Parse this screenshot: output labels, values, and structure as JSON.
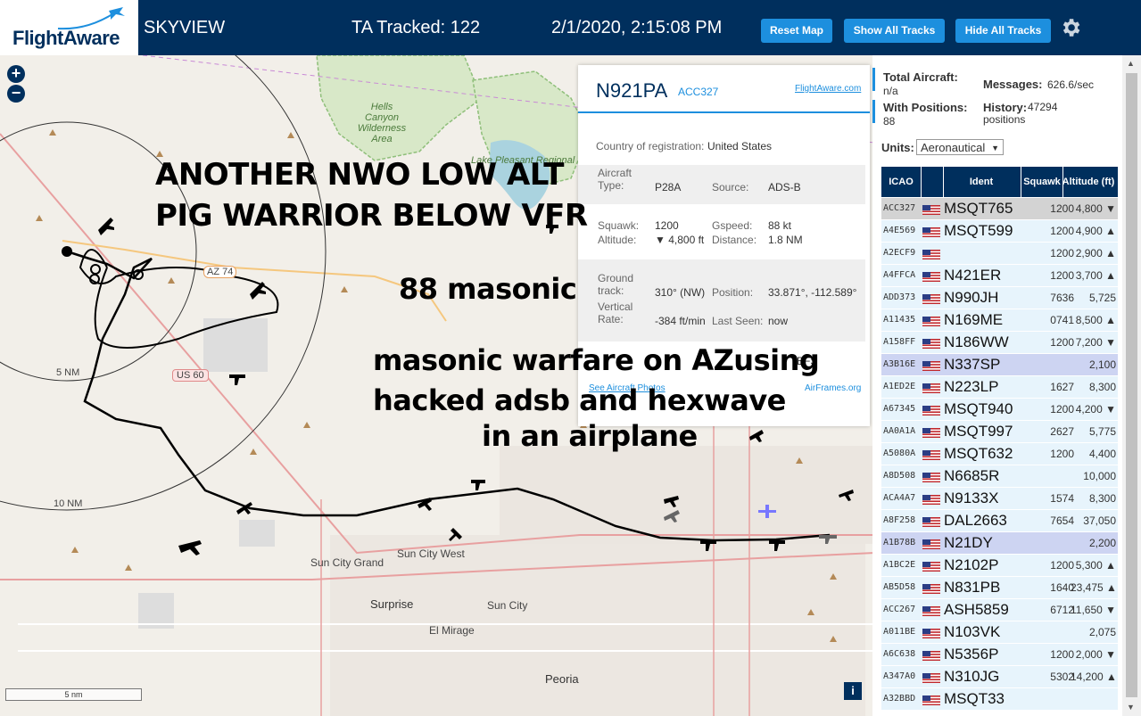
{
  "header": {
    "brand": "FlightAware",
    "app_name": "SKYVIEW",
    "tracked_label": "TA Tracked: 122",
    "datetime": "2/1/2020, 2:15:08 PM",
    "reset_map": "Reset Map",
    "show_all_tracks": "Show All Tracks",
    "hide_all_tracks": "Hide All Tracks",
    "settings_icon": "gear-icon"
  },
  "map": {
    "zoom_in": "+",
    "zoom_out": "−",
    "labels": {
      "hells_canyon": "Hells Canyon Wilderness Area",
      "lake_pleasant": "Lake Pleasant Regional",
      "az74": "AZ 74",
      "us60": "US 60",
      "range5": "5 NM",
      "range10": "10 NM",
      "sun_city_grand": "Sun City Grand",
      "sun_city_west": "Sun City West",
      "sun_city": "Sun City",
      "surprise": "Surprise",
      "el_mirage": "El Mirage",
      "peoria": "Peoria"
    },
    "scale_label": "5 nm",
    "info_button": "i"
  },
  "overlay_text": {
    "line1": "ANOTHER NWO LOW ALT",
    "line2": "PIG WARRIOR BELOW VFR",
    "line3": "88 masonic",
    "line4": "masonic warfare on AZusing",
    "line5": "hacked adsb and hexwave",
    "line6": "in an airplane"
  },
  "popup": {
    "ident": "N921PA",
    "icao": "ACC327",
    "fa_link": "FlightAware.com",
    "country_label": "Country of registration:",
    "country": "United States",
    "aircraft_type_label": "Aircraft Type:",
    "aircraft_type": "P28A",
    "source_label": "Source:",
    "source": "ADS-B",
    "squawk_label": "Squawk:",
    "squawk": "1200",
    "altitude_label": "Altitude:",
    "altitude": "▼ 4,800 ft",
    "gspeed_label": "Gspeed:",
    "gspeed": "88 kt",
    "distance_label": "Distance:",
    "distance": "1.8 NM",
    "ground_track_label": "Ground track:",
    "ground_track": "310° (NW)",
    "position_label": "Position:",
    "position": "33.871°, -112.589°",
    "vertical_rate_label": "Vertical Rate:",
    "vertical_rate": "-384 ft/min",
    "last_seen_label": "Last Seen:",
    "last_seen": "now",
    "bottom_fragment": "BFS",
    "see_photos": "See Aircraft Photos",
    "airframes_link": "AirFrames.org"
  },
  "panel": {
    "total_aircraft_label": "Total Aircraft:",
    "total_aircraft": "n/a",
    "with_positions_label": "With Positions:",
    "with_positions": "88",
    "messages_label": "Messages:",
    "messages": "626.6/sec",
    "history_label": "History:",
    "history": "47294 positions",
    "units_label": "Units:",
    "units_value": "Aeronautical",
    "columns": {
      "icao": "ICAO",
      "ident": "Ident",
      "squawk": "Squawk",
      "altitude": "Altitude (ft)"
    },
    "rows": [
      {
        "icao": "ACC327",
        "ident": "MSQT765",
        "squawk": "1200",
        "alt": "4,800 ▼",
        "hl": "sel"
      },
      {
        "icao": "A4E569",
        "ident": "MSQT599",
        "squawk": "1200",
        "alt": "4,900 ▲",
        "hl": ""
      },
      {
        "icao": "A2ECF9",
        "ident": "",
        "squawk": "1200",
        "alt": "2,900 ▲",
        "hl": ""
      },
      {
        "icao": "A4FFCA",
        "ident": "N421ER",
        "squawk": "1200",
        "alt": "3,700 ▲",
        "hl": ""
      },
      {
        "icao": "ADD373",
        "ident": "N990JH",
        "squawk": "7636",
        "alt": "5,725",
        "hl": ""
      },
      {
        "icao": "A11435",
        "ident": "N169ME",
        "squawk": "0741",
        "alt": "8,500 ▲",
        "hl": ""
      },
      {
        "icao": "A158FF",
        "ident": "N186WW",
        "squawk": "1200",
        "alt": "7,200 ▼",
        "hl": ""
      },
      {
        "icao": "A3B16E",
        "ident": "N337SP",
        "squawk": "",
        "alt": "2,100",
        "hl": "blue"
      },
      {
        "icao": "A1ED2E",
        "ident": "N223LP",
        "squawk": "1627",
        "alt": "8,300",
        "hl": ""
      },
      {
        "icao": "A67345",
        "ident": "MSQT940",
        "squawk": "1200",
        "alt": "4,200 ▼",
        "hl": ""
      },
      {
        "icao": "AA0A1A",
        "ident": "MSQT997",
        "squawk": "2627",
        "alt": "5,775",
        "hl": ""
      },
      {
        "icao": "A5080A",
        "ident": "MSQT632",
        "squawk": "1200",
        "alt": "4,400",
        "hl": ""
      },
      {
        "icao": "A8D508",
        "ident": "N6685R",
        "squawk": "",
        "alt": "10,000",
        "hl": ""
      },
      {
        "icao": "ACA4A7",
        "ident": "N9133X",
        "squawk": "1574",
        "alt": "8,300",
        "hl": ""
      },
      {
        "icao": "A8F258",
        "ident": "DAL2663",
        "squawk": "7654",
        "alt": "37,050",
        "hl": ""
      },
      {
        "icao": "A1B78B",
        "ident": "N21DY",
        "squawk": "",
        "alt": "2,200",
        "hl": "blue"
      },
      {
        "icao": "A1BC2E",
        "ident": "N2102P",
        "squawk": "1200",
        "alt": "5,300 ▲",
        "hl": ""
      },
      {
        "icao": "AB5D58",
        "ident": "N831PB",
        "squawk": "1640",
        "alt": "23,475 ▲",
        "hl": ""
      },
      {
        "icao": "ACC267",
        "ident": "ASH5859",
        "squawk": "6712",
        "alt": "11,650 ▼",
        "hl": ""
      },
      {
        "icao": "A011BE",
        "ident": "N103VK",
        "squawk": "",
        "alt": "2,075",
        "hl": ""
      },
      {
        "icao": "A6C638",
        "ident": "N5356P",
        "squawk": "1200",
        "alt": "2,000 ▼",
        "hl": ""
      },
      {
        "icao": "A347A0",
        "ident": "N310JG",
        "squawk": "5302",
        "alt": "14,200 ▲",
        "hl": ""
      },
      {
        "icao": "A32BBD",
        "ident": "MSQT33",
        "squawk": "",
        "alt": "",
        "hl": ""
      }
    ]
  },
  "colors": {
    "header_bg": "#002f5d",
    "button_bg": "#1d8fde",
    "row_bg": "#e7f4fc",
    "row_selected": "#d3d3d3",
    "row_highlight": "#cdd4f2"
  }
}
